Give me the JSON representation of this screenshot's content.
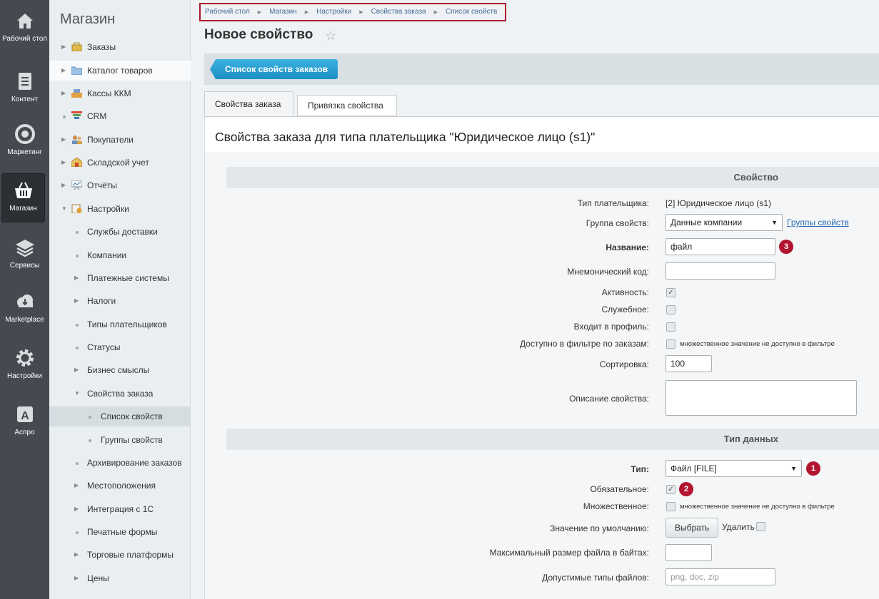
{
  "iconbar": {
    "items": [
      {
        "label": "Рабочий стол",
        "icon": "home-icon"
      },
      {
        "label": "Контент",
        "icon": "document-icon"
      },
      {
        "label": "Маркетинг",
        "icon": "target-icon"
      },
      {
        "label": "Магазин",
        "icon": "basket-icon"
      },
      {
        "label": "Сервисы",
        "icon": "layers-icon"
      },
      {
        "label": "Marketplace",
        "icon": "cloud-download-icon"
      },
      {
        "label": "Настройки",
        "icon": "gear-icon"
      },
      {
        "label": "Аспро",
        "icon": "letter-a-icon"
      }
    ]
  },
  "menu": {
    "title": "Магазин",
    "items": [
      {
        "label": "Заказы"
      },
      {
        "label": "Каталог товаров"
      },
      {
        "label": "Кассы ККМ"
      },
      {
        "label": "CRM"
      },
      {
        "label": "Покупатели"
      },
      {
        "label": "Складской учет"
      },
      {
        "label": "Отчёты"
      },
      {
        "label": "Настройки"
      },
      {
        "label": "Службы доставки"
      },
      {
        "label": "Компании"
      },
      {
        "label": "Платежные системы"
      },
      {
        "label": "Налоги"
      },
      {
        "label": "Типы плательщиков"
      },
      {
        "label": "Статусы"
      },
      {
        "label": "Бизнес смыслы"
      },
      {
        "label": "Свойства заказа"
      },
      {
        "label": "Список свойств"
      },
      {
        "label": "Группы свойств"
      },
      {
        "label": "Архивирование заказов"
      },
      {
        "label": "Местоположения"
      },
      {
        "label": "Интеграция с 1С"
      },
      {
        "label": "Печатные формы"
      },
      {
        "label": "Торговые платформы"
      },
      {
        "label": "Цены"
      }
    ]
  },
  "breadcrumb": [
    "Рабочий стол",
    "Магазин",
    "Настройки",
    "Свойства заказа",
    "Список свойств"
  ],
  "page": {
    "title": "Новое свойство",
    "list_button": "Список свойств заказов",
    "tabs": [
      "Свойства заказа",
      "Привязка свойства"
    ],
    "content_title": "Свойства заказа для типа плательщика \"Юридическое лицо (s1)\""
  },
  "form": {
    "section_property": "Свойство",
    "payer_type_label": "Тип плательщика:",
    "payer_type_value": "[2] Юридическое лицо (s1)",
    "group_label": "Группа свойств:",
    "group_value": "Данные компании",
    "group_link": "Группы свойств",
    "name_label": "Название:",
    "name_value": "файл",
    "code_label": "Мнемонический код:",
    "code_value": "",
    "active_label": "Активность:",
    "active_checked": true,
    "service_label": "Служебное:",
    "profile_label": "Входит в профиль:",
    "filter_label": "Доступно в фильтре по заказам:",
    "filter_note": "множественное значение не доступно в фильтре",
    "sort_label": "Сортировка:",
    "sort_value": "100",
    "description_label": "Описание свойства:",
    "section_type": "Тип данных",
    "type_label": "Тип:",
    "type_value": "Файл [FILE]",
    "required_label": "Обязательное:",
    "required_checked": true,
    "multiple_label": "Множественное:",
    "multiple_note": "множественное значение не доступно в фильтре",
    "default_label": "Значение по умолчанию:",
    "choose_button": "Выбрать",
    "delete_label": "Удалить",
    "maxsize_label": "Максимальный размер файла в байтах:",
    "maxsize_value": "",
    "filetypes_label": "Допустимые типы файлов:",
    "filetypes_placeholder": "png, doc, zip"
  },
  "badges": {
    "name": "3",
    "type": "1",
    "required": "2"
  },
  "colors": {
    "accent": "#1a8fc4",
    "badge": "#b31530",
    "breadcrumb_border": "#b0142a",
    "iconbar": "#444a50"
  }
}
